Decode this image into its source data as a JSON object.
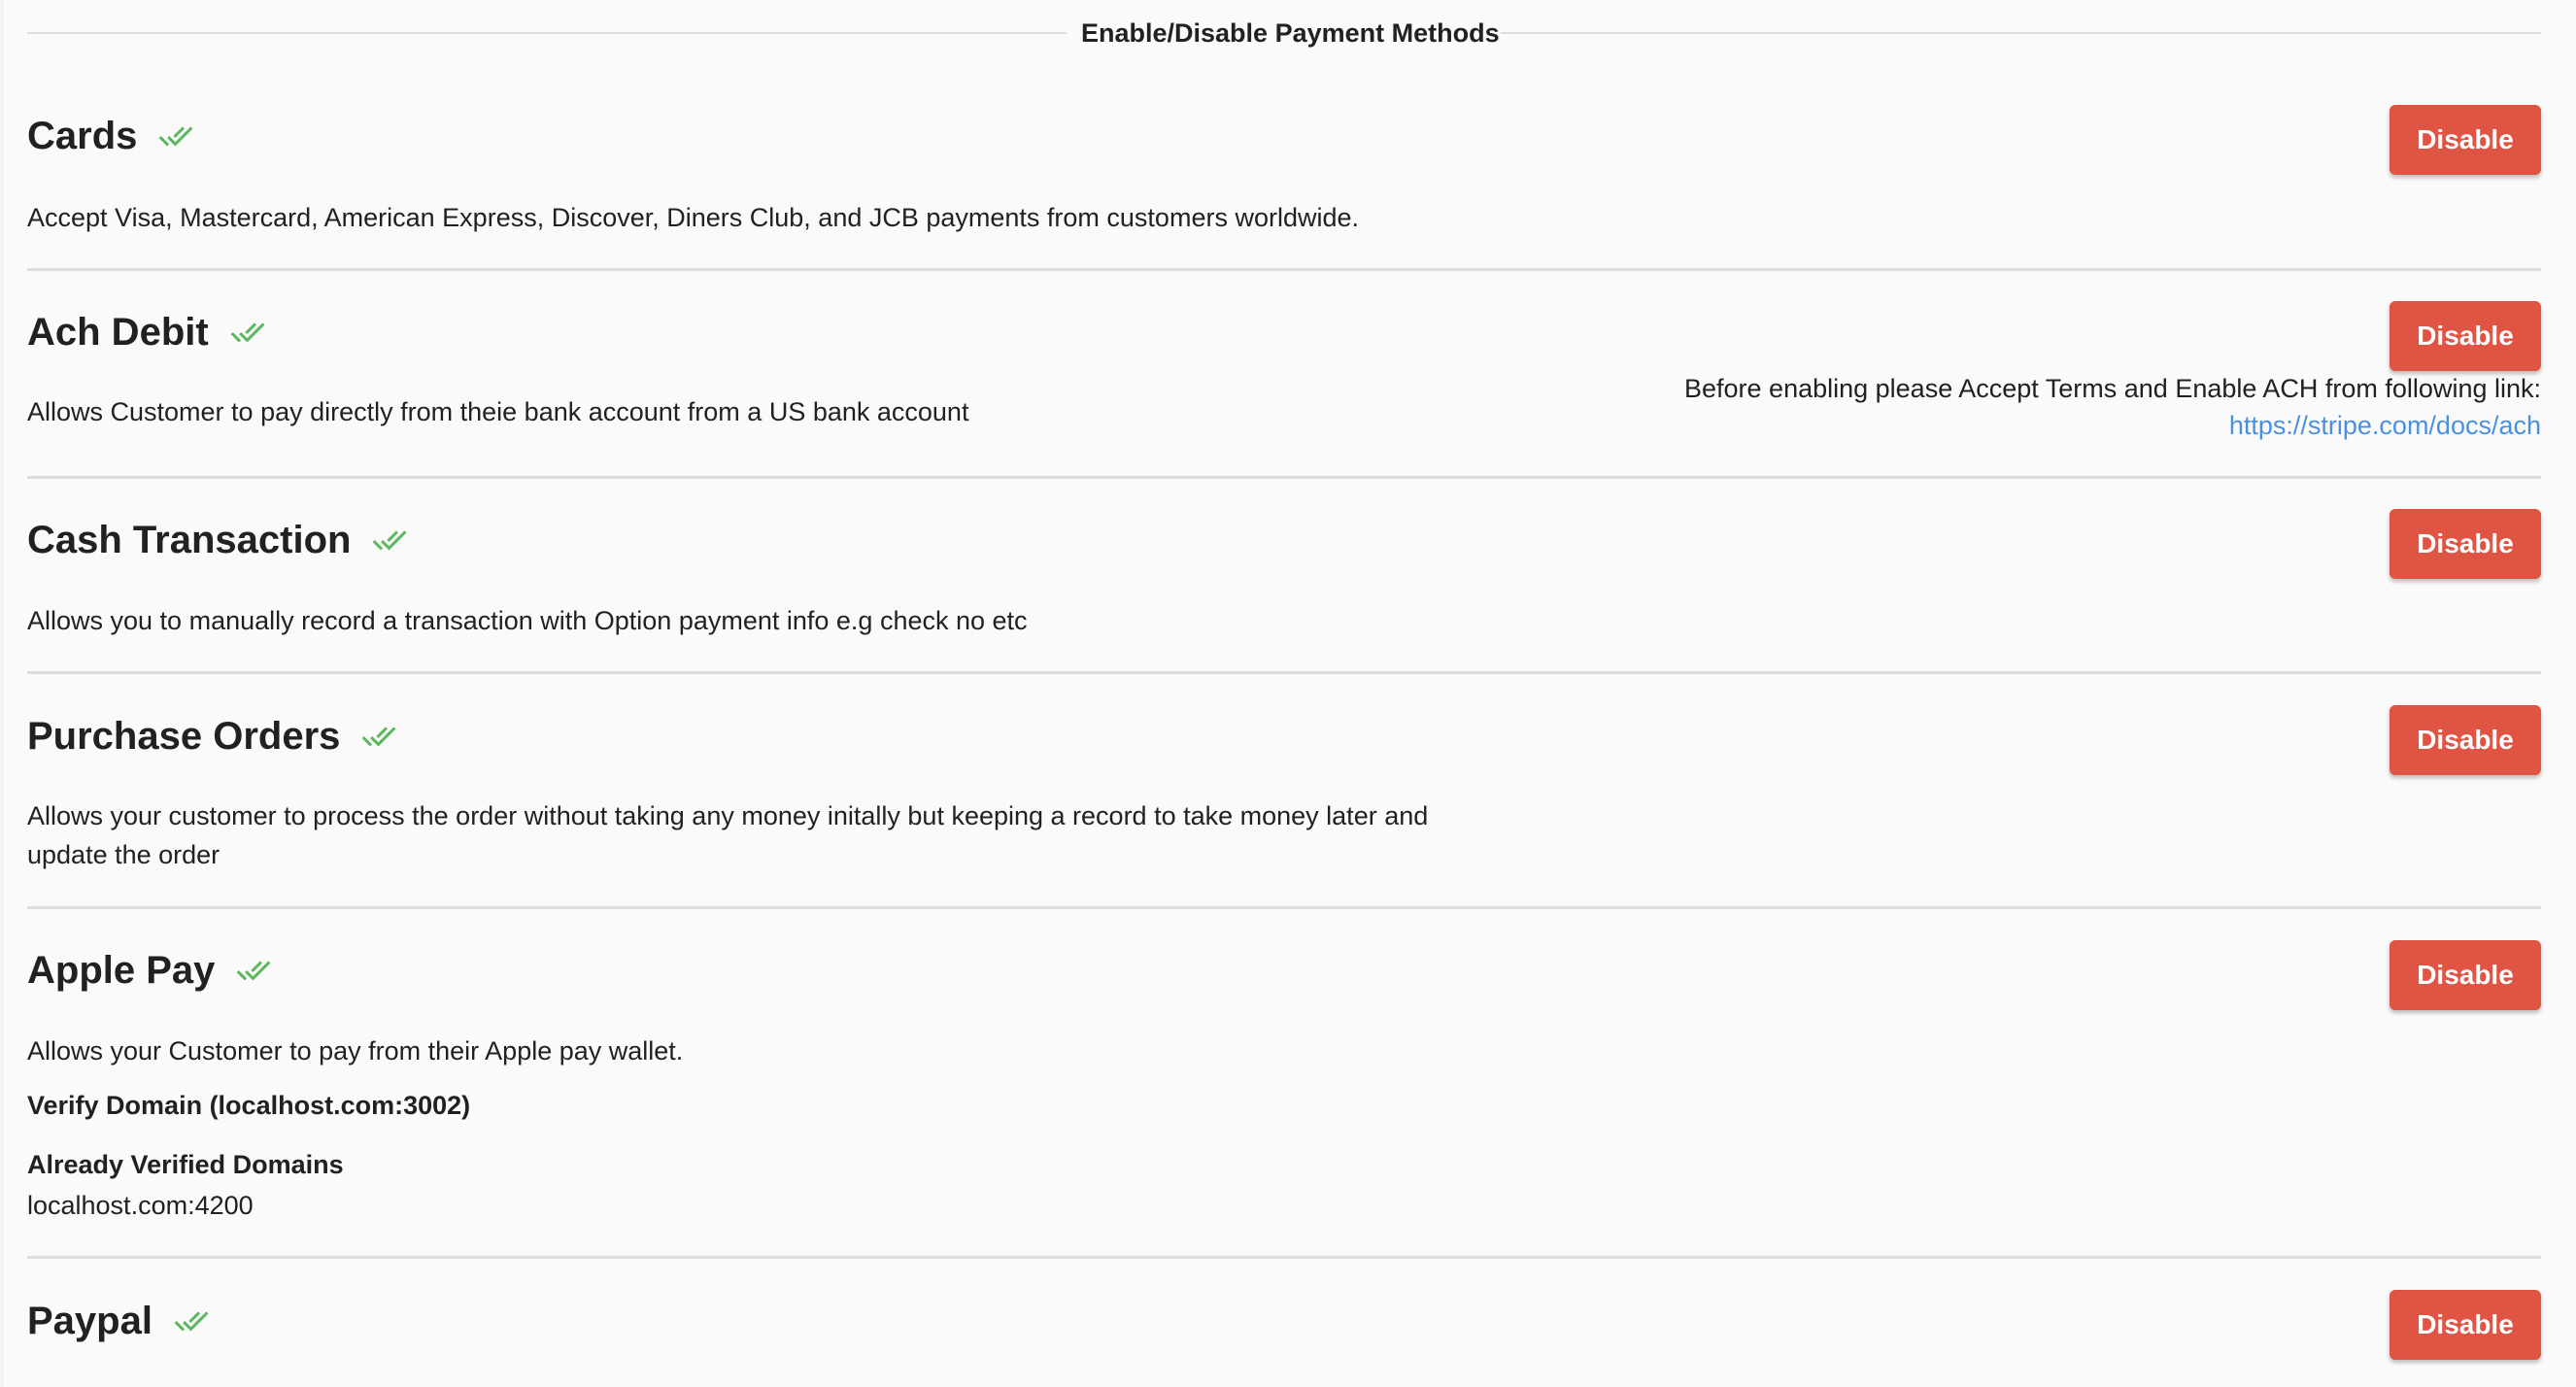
{
  "legend": {
    "title": "Enable/Disable Payment Methods"
  },
  "colors": {
    "check": "#5cb85c",
    "disable_button": "#e05443",
    "link": "#4a90e2"
  },
  "methods": [
    {
      "name": "Cards",
      "status_icon": "done-all-icon",
      "button_label": "Disable",
      "description": "Accept Visa, Mastercard, American Express, Discover, Diners Club, and JCB payments from customers worldwide."
    },
    {
      "name": "Ach Debit",
      "status_icon": "done-all-icon",
      "button_label": "Disable",
      "description": "Allows Customer to pay directly from theie bank account from a US bank account",
      "note": "Before enabling please Accept Terms and Enable ACH from following link:",
      "link": "https://stripe.com/docs/ach"
    },
    {
      "name": "Cash Transaction",
      "status_icon": "done-all-icon",
      "button_label": "Disable",
      "description": "Allows you to manually record a transaction with Option payment info e.g check no etc"
    },
    {
      "name": "Purchase Orders",
      "status_icon": "done-all-icon",
      "button_label": "Disable",
      "description": "Allows your customer to process the order without taking any money initally but keeping a record to take money later and update the order"
    },
    {
      "name": "Apple Pay",
      "status_icon": "done-all-icon",
      "button_label": "Disable",
      "description": "Allows your Customer to pay from their Apple pay wallet.",
      "verify_domain": "Verify Domain (localhost.com:3002)",
      "verified_heading": "Already Verified Domains",
      "verified_domains": [
        "localhost.com:4200"
      ]
    },
    {
      "name": "Paypal",
      "status_icon": "done-all-icon",
      "button_label": "Disable"
    }
  ]
}
